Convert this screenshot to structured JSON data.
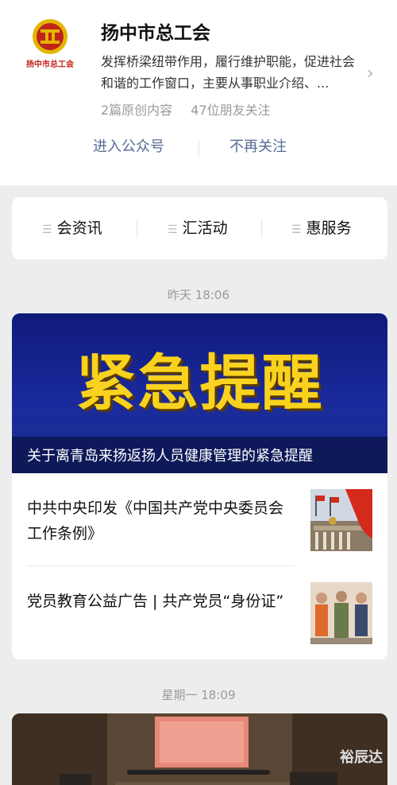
{
  "account": {
    "logo_text": "扬中市总工会",
    "name": "扬中市总工会",
    "description": "发挥桥梁纽带作用，履行维护职能，促进社会和谐的工作窗口，主要从事职业介绍、...",
    "original_count": "2篇原创内容",
    "friends_follow": "47位朋友关注",
    "enter_label": "进入公众号",
    "unfollow_label": "不再关注"
  },
  "menu": {
    "items": [
      {
        "label": "会资讯"
      },
      {
        "label": "汇活动"
      },
      {
        "label": "惠服务"
      }
    ]
  },
  "feed": [
    {
      "time": "昨天 18:06",
      "banner_text": "紧急提醒",
      "banner_caption": "关于离青岛来扬返扬人员健康管理的紧急提醒",
      "articles": [
        {
          "title": "中共中央印发《中国共产党中央委员会工作条例》"
        },
        {
          "title": "党员教育公益广告 | 共产党员“身份证”"
        }
      ]
    },
    {
      "time": "星期一 18:09"
    }
  ],
  "watermark": "裕辰达",
  "colors": {
    "link": "#576b95",
    "banner_bg": "#1a2a9c",
    "banner_text": "#f8d21e",
    "logo_red": "#c0251b"
  }
}
